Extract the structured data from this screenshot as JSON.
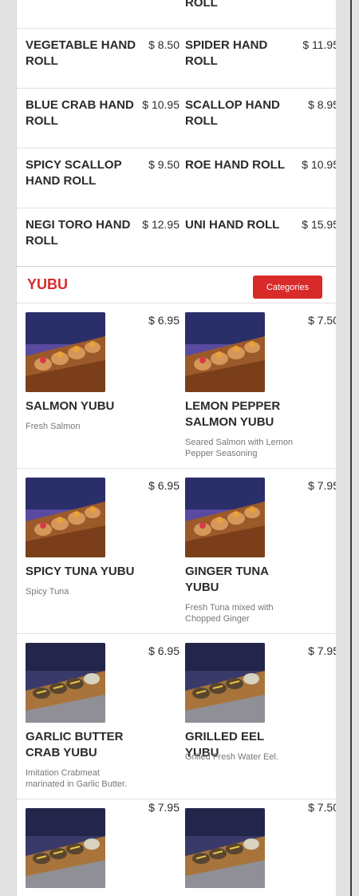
{
  "top_partial": {
    "name_tail": "ROLL"
  },
  "hand_rolls": [
    {
      "left": {
        "name": "VEGETABLE HAND ROLL",
        "price": "$ 8.50"
      },
      "right": {
        "name": "SPIDER HAND ROLL",
        "price": "$ 11.95"
      }
    },
    {
      "left": {
        "name": "BLUE CRAB HAND ROLL",
        "price": "$ 10.95"
      },
      "right": {
        "name": "SCALLOP HAND ROLL",
        "price": "$ 8.95"
      }
    },
    {
      "left": {
        "name": "SPICY SCALLOP HAND ROLL",
        "price": "$ 9.50"
      },
      "right": {
        "name": "ROE HAND ROLL",
        "price": "$ 10.95"
      }
    },
    {
      "left": {
        "name": "NEGI TORO HAND ROLL",
        "price": "$ 12.95"
      },
      "right": {
        "name": "UNI HAND ROLL",
        "price": "$ 15.95"
      }
    }
  ],
  "section": {
    "title": "YUBU",
    "categories_button": "Categories"
  },
  "yubu_items": [
    {
      "left": {
        "name": "SALMON YUBU",
        "price": "$ 6.95",
        "desc": "Fresh Salmon",
        "image": "salmon-yubu-photo"
      },
      "right": {
        "name": "LEMON PEPPER SALMON YUBU",
        "price": "$ 7.50",
        "desc": "Seared Salmon with Lemon Pepper Seasoning",
        "image": "lemon-pepper-salmon-yubu-photo"
      }
    },
    {
      "left": {
        "name": "SPICY TUNA YUBU",
        "price": "$ 6.95",
        "desc": "Spicy Tuna",
        "image": "spicy-tuna-yubu-photo"
      },
      "right": {
        "name": "GINGER TUNA YUBU",
        "price": "$ 7.95",
        "desc": "Fresh Tuna mixed with Chopped Ginger",
        "image": "ginger-tuna-yubu-photo"
      }
    },
    {
      "left": {
        "name": "GARLIC BUTTER CRAB YUBU",
        "price": "$ 6.95",
        "desc": "Imitation Crabmeat marinated in Garlic Butter.",
        "image": "garlic-butter-crab-yubu-photo"
      },
      "right": {
        "name": "GRILLED EEL YUBU",
        "price": "$ 7.95",
        "desc": "Grilled Fresh Water Eel.",
        "image": "grilled-eel-yubu-photo"
      }
    },
    {
      "left": {
        "price": "$ 7.95",
        "image": "yubu-photo"
      },
      "right": {
        "price": "$ 7.50",
        "image": "yubu-photo"
      }
    }
  ]
}
